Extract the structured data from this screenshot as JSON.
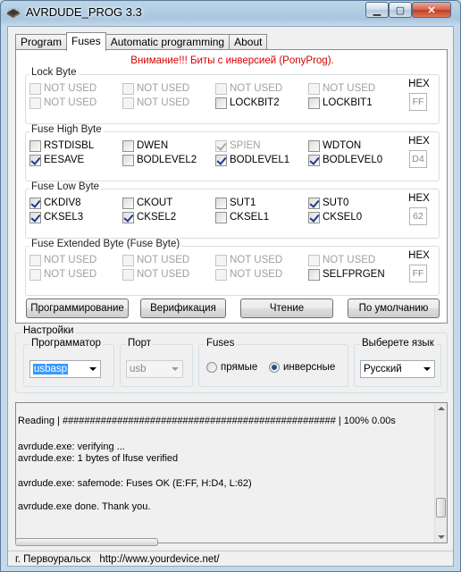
{
  "window": {
    "title": "AVRDUDE_PROG 3.3",
    "minimize": "▁",
    "maximize": "▢",
    "close": "✕"
  },
  "tabs": [
    "Program",
    "Fuses",
    "Automatic programming",
    "About"
  ],
  "warning": "Внимание!!! Биты с инверсией (PonyProg).",
  "groups": {
    "lock": {
      "title": "Lock Byte",
      "hex_label": "HEX",
      "hex_value": "FF",
      "row1": [
        {
          "label": "NOT USED",
          "checked": false,
          "disabled": true
        },
        {
          "label": "NOT USED",
          "checked": false,
          "disabled": true
        },
        {
          "label": "NOT USED",
          "checked": false,
          "disabled": true
        },
        {
          "label": "NOT USED",
          "checked": false,
          "disabled": true
        }
      ],
      "row2": [
        {
          "label": "NOT USED",
          "checked": false,
          "disabled": true
        },
        {
          "label": "NOT USED",
          "checked": false,
          "disabled": true
        },
        {
          "label": "LOCKBIT2",
          "checked": false,
          "disabled": false
        },
        {
          "label": "LOCKBIT1",
          "checked": false,
          "disabled": false
        }
      ]
    },
    "high": {
      "title": "Fuse High Byte",
      "hex_label": "HEX",
      "hex_value": "D4",
      "row1": [
        {
          "label": "RSTDISBL",
          "checked": false,
          "disabled": false
        },
        {
          "label": "DWEN",
          "checked": false,
          "disabled": false
        },
        {
          "label": "SPIEN",
          "checked": true,
          "disabled": true
        },
        {
          "label": "WDTON",
          "checked": false,
          "disabled": false
        }
      ],
      "row2": [
        {
          "label": "EESAVE",
          "checked": true,
          "disabled": false
        },
        {
          "label": "BODLEVEL2",
          "checked": false,
          "disabled": false
        },
        {
          "label": "BODLEVEL1",
          "checked": true,
          "disabled": false
        },
        {
          "label": "BODLEVEL0",
          "checked": true,
          "disabled": false
        }
      ]
    },
    "low": {
      "title": "Fuse Low Byte",
      "hex_label": "HEX",
      "hex_value": "62",
      "row1": [
        {
          "label": "CKDIV8",
          "checked": true,
          "disabled": false
        },
        {
          "label": "CKOUT",
          "checked": false,
          "disabled": false
        },
        {
          "label": "SUT1",
          "checked": false,
          "disabled": false
        },
        {
          "label": "SUT0",
          "checked": true,
          "disabled": false
        }
      ],
      "row2": [
        {
          "label": "CKSEL3",
          "checked": true,
          "disabled": false
        },
        {
          "label": "CKSEL2",
          "checked": true,
          "disabled": false
        },
        {
          "label": "CKSEL1",
          "checked": false,
          "disabled": false
        },
        {
          "label": "CKSEL0",
          "checked": true,
          "disabled": false
        }
      ]
    },
    "ext": {
      "title": "Fuse Extended Byte (Fuse Byte)",
      "hex_label": "HEX",
      "hex_value": "FF",
      "row1": [
        {
          "label": "NOT USED",
          "checked": false,
          "disabled": true
        },
        {
          "label": "NOT USED",
          "checked": false,
          "disabled": true
        },
        {
          "label": "NOT USED",
          "checked": false,
          "disabled": true
        },
        {
          "label": "NOT USED",
          "checked": false,
          "disabled": true
        }
      ],
      "row2": [
        {
          "label": "NOT USED",
          "checked": false,
          "disabled": true
        },
        {
          "label": "NOT USED",
          "checked": false,
          "disabled": true
        },
        {
          "label": "NOT USED",
          "checked": false,
          "disabled": true
        },
        {
          "label": "SELFPRGEN",
          "checked": false,
          "disabled": false
        }
      ]
    }
  },
  "actions": [
    "Программирование",
    "Верификация",
    "Чтение",
    "По умолчанию"
  ],
  "settings": {
    "title": "Настройки",
    "programmer": {
      "label": "Программатор",
      "value": "usbasp"
    },
    "port": {
      "label": "Порт",
      "value": "usb"
    },
    "fuses": {
      "label": "Fuses",
      "direct": "прямые",
      "inverse": "инверсные",
      "selected": "inverse"
    },
    "language": {
      "label": "Выберете язык",
      "value": "Русский"
    }
  },
  "log": [
    "Reading | ################################################## | 100% 0.00s",
    "",
    "avrdude.exe: verifying ...",
    "avrdude.exe: 1 bytes of lfuse verified",
    "",
    "avrdude.exe: safemode: Fuses OK (E:FF, H:D4, L:62)",
    "",
    "avrdude.exe done.  Thank you."
  ],
  "status": {
    "city": "г. Первоуральск",
    "url": "http://www.yourdevice.net/"
  }
}
